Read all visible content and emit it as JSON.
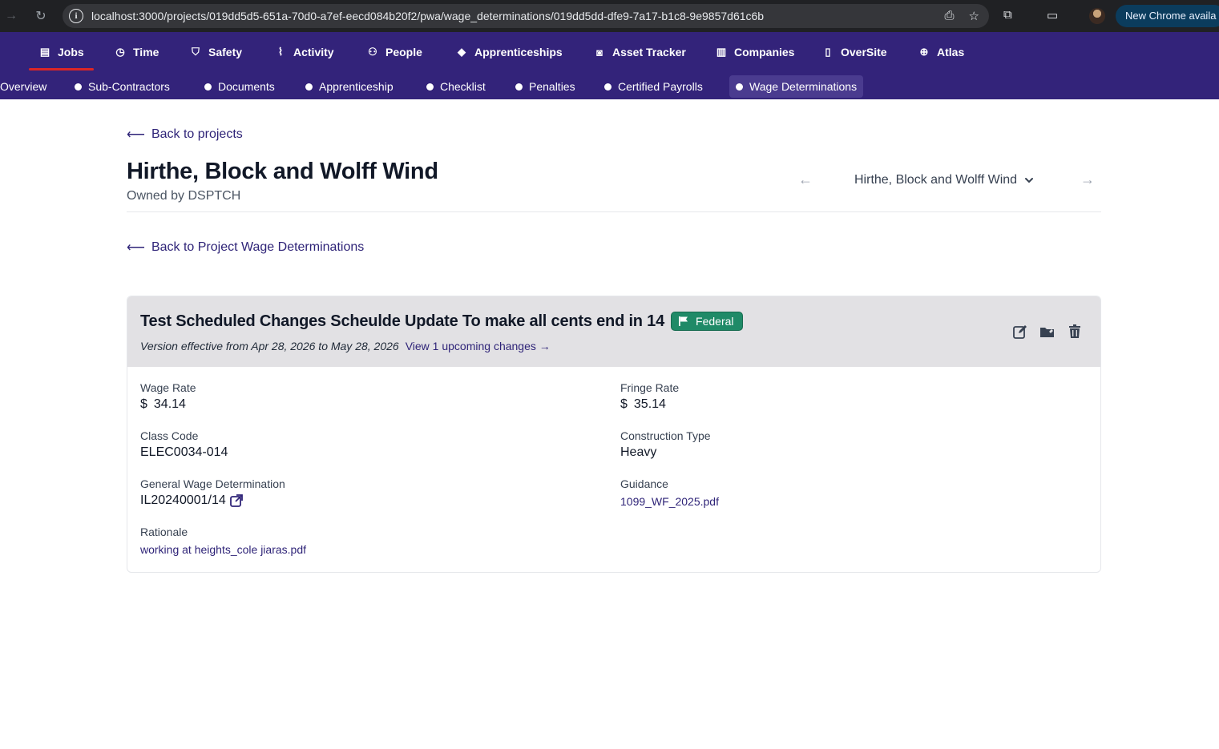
{
  "browser": {
    "url": "localhost:3000/projects/019dd5d5-651a-70d0-a7ef-eecd084b20f2/pwa/wage_determinations/019dd5dd-dfe9-7a17-b1c8-9e9857d61c6b",
    "new_chrome_label": "New Chrome availa"
  },
  "topnav": {
    "items": [
      {
        "label": "Jobs",
        "icon": "briefcase-icon"
      },
      {
        "label": "Time",
        "icon": "clock-icon"
      },
      {
        "label": "Safety",
        "icon": "shield-icon"
      },
      {
        "label": "Activity",
        "icon": "pulse-icon"
      },
      {
        "label": "People",
        "icon": "users-icon"
      },
      {
        "label": "Apprenticeships",
        "icon": "graduation-cap-icon"
      },
      {
        "label": "Asset Tracker",
        "icon": "camera-icon"
      },
      {
        "label": "Companies",
        "icon": "building-icon"
      },
      {
        "label": "OverSite",
        "icon": "map-icon"
      },
      {
        "label": "Atlas",
        "icon": "globe-icon"
      }
    ],
    "active": "Jobs"
  },
  "subnav": {
    "items": [
      "Overview",
      "Sub-Contractors",
      "Documents",
      "Apprenticeship",
      "Checklist",
      "Penalties",
      "Certified Payrolls",
      "Wage Determinations"
    ],
    "active": "Wage Determinations"
  },
  "page": {
    "back_projects": "Back to projects",
    "project_title": "Hirthe, Block and Wolff Wind",
    "owner": "Owned by DSPTCH",
    "project_selector": "Hirthe, Block and Wolff Wind",
    "back_wage_determinations": "Back to Project Wage Determinations"
  },
  "card": {
    "title": "Test Scheduled Changes Scheulde Update To make all cents end in 14",
    "badge": "Federal",
    "version_text": "Version effective from Apr 28, 2026 to May 28, 2026",
    "upcoming_link": "View 1 upcoming changes",
    "fields": {
      "wage_rate_label": "Wage Rate",
      "wage_rate_currency": "$",
      "wage_rate_value": "34.14",
      "fringe_rate_label": "Fringe Rate",
      "fringe_rate_currency": "$",
      "fringe_rate_value": "35.14",
      "class_code_label": "Class Code",
      "class_code_value": "ELEC0034-014",
      "construction_type_label": "Construction Type",
      "construction_type_value": "Heavy",
      "gwd_label": "General Wage Determination",
      "gwd_value": "IL20240001/14",
      "guidance_label": "Guidance",
      "guidance_file": "1099_WF_2025.pdf",
      "rationale_label": "Rationale",
      "rationale_file": "working at heights_cole jiaras.pdf"
    }
  },
  "colors": {
    "nav_bg": "#33237a",
    "active_underline": "#dc2626",
    "link": "#2f2478",
    "badge": "#1f8a67",
    "card_header": "#e2e1e4"
  }
}
